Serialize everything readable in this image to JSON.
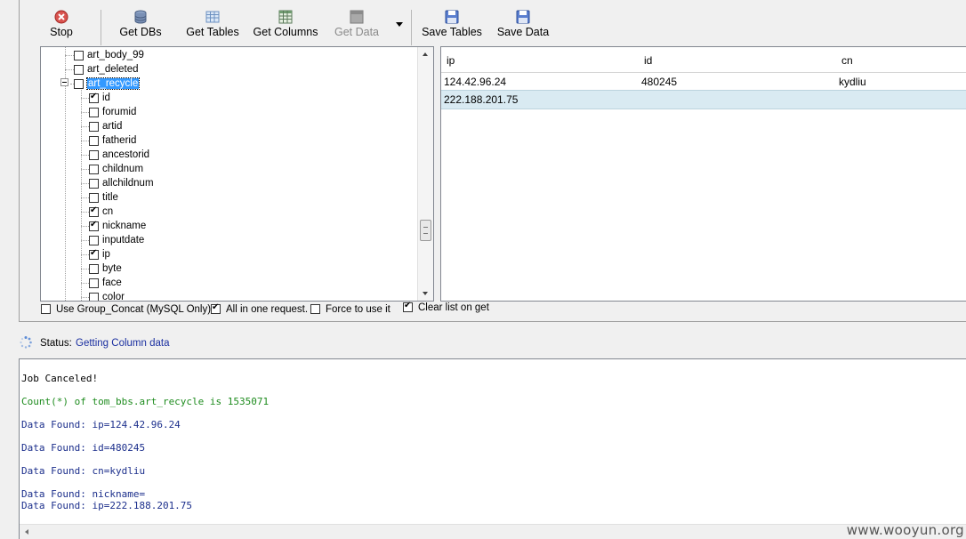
{
  "toolbar": {
    "stop": "Stop",
    "get_dbs": "Get DBs",
    "get_tables": "Get Tables",
    "get_columns": "Get Columns",
    "get_data": "Get Data",
    "save_tables": "Save Tables",
    "save_data": "Save Data"
  },
  "tree": {
    "tables": [
      {
        "label": "art_body_99",
        "checked": false
      },
      {
        "label": "art_deleted",
        "checked": false
      },
      {
        "label": "art_recycle",
        "checked": false,
        "selected": true,
        "expanded": true
      }
    ],
    "columns": [
      {
        "label": "id",
        "checked": true
      },
      {
        "label": "forumid",
        "checked": false
      },
      {
        "label": "artid",
        "checked": false
      },
      {
        "label": "fatherid",
        "checked": false
      },
      {
        "label": "ancestorid",
        "checked": false
      },
      {
        "label": "childnum",
        "checked": false
      },
      {
        "label": "allchildnum",
        "checked": false
      },
      {
        "label": "title",
        "checked": false
      },
      {
        "label": "cn",
        "checked": true
      },
      {
        "label": "nickname",
        "checked": true
      },
      {
        "label": "inputdate",
        "checked": false
      },
      {
        "label": "ip",
        "checked": true
      },
      {
        "label": "byte",
        "checked": false
      },
      {
        "label": "face",
        "checked": false
      },
      {
        "label": "color",
        "checked": false
      }
    ]
  },
  "grid": {
    "headers": [
      "ip",
      "id",
      "cn"
    ],
    "rows": [
      [
        "124.42.96.24",
        "480245",
        "kydliu"
      ],
      [
        "222.188.201.75",
        "",
        ""
      ]
    ]
  },
  "options": {
    "group_concat": {
      "label": "Use Group_Concat (MySQL Only)",
      "checked": false
    },
    "all_in_one": {
      "label": "All in one request.",
      "checked": true
    },
    "force": {
      "label": "Force to use it",
      "checked": false
    },
    "clear_list": {
      "label": "Clear list on get",
      "checked": true
    }
  },
  "status": {
    "label": "Status:",
    "value": "Getting Column data"
  },
  "log": {
    "lines": [
      {
        "text": "Job Canceled!",
        "color": "black"
      },
      {
        "text": "Count(*) of tom_bbs.art_recycle is 1535071",
        "color": "green"
      },
      {
        "text": "Data Found: ip=124.42.96.24",
        "color": "blue"
      },
      {
        "text": "Data Found: id=480245",
        "color": "blue"
      },
      {
        "text": "Data Found: cn=kydliu",
        "color": "blue"
      },
      {
        "text": "Data Found: nickname=",
        "color": "blue"
      },
      {
        "text": "Data Found: ip=222.188.201.75",
        "color": "blue"
      }
    ]
  },
  "watermark": "www.wooyun.org"
}
